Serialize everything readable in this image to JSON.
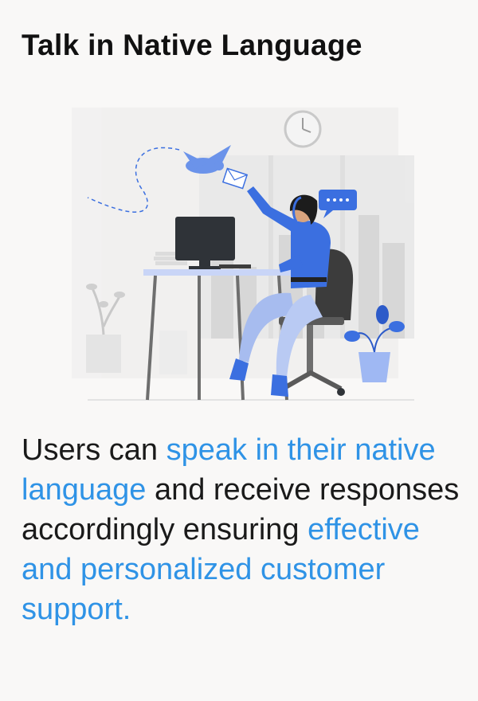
{
  "title": "Talk in Native Language",
  "description": {
    "part1": "Users can ",
    "highlight1": "speak in their native language",
    "part2": " and receive responses accordingly ensuring ",
    "highlight2": "effective and personalized customer support."
  },
  "colors": {
    "accent": "#2f93e6",
    "illustration_blue": "#3b6fe0",
    "background": "#f9f8f7"
  },
  "illustration_icon": "customer-support-agent-illustration"
}
